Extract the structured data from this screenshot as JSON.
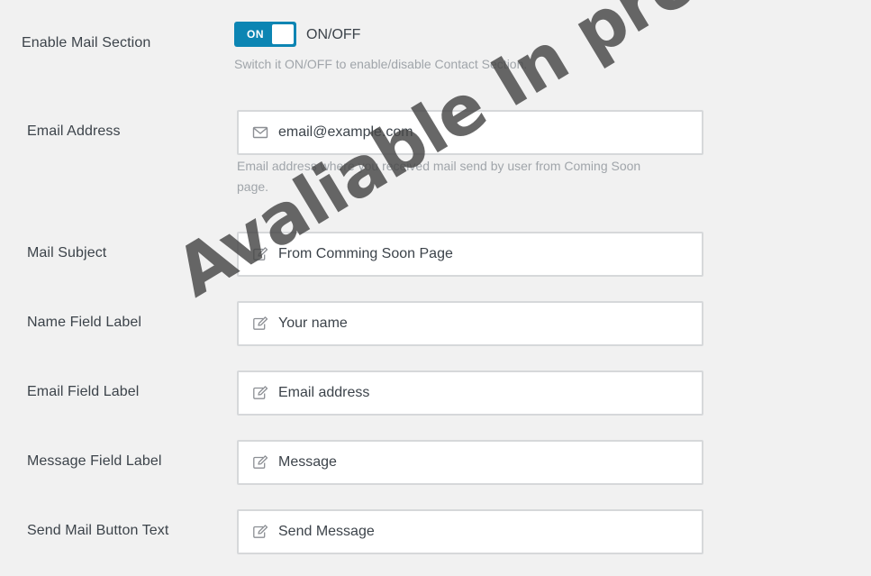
{
  "enable_mail": {
    "label": "Enable Mail Section",
    "toggle_state": "ON",
    "toggle_caption": "ON/OFF",
    "help": "Switch it ON/OFF to enable/disable Contact Section."
  },
  "email_address": {
    "label": "Email Address",
    "value": "email@example.com",
    "help_line1": "Email address where you received mail send by user from Coming Soon",
    "help_line2": "page.",
    "icon": "envelope-icon"
  },
  "mail_subject": {
    "label": "Mail Subject",
    "value": "From Comming Soon Page",
    "icon": "edit-icon"
  },
  "name_field_label": {
    "label": "Name Field Label",
    "value": "Your name",
    "icon": "edit-icon"
  },
  "email_field_label": {
    "label": "Email Field Label",
    "value": "Email address",
    "icon": "edit-icon"
  },
  "message_field_label": {
    "label": "Message Field Label",
    "value": "Message",
    "icon": "edit-icon"
  },
  "send_button_text": {
    "label": "Send Mail Button Text",
    "value": "Send Message",
    "icon": "edit-icon"
  },
  "watermark": "Avaliable In pro version",
  "colors": {
    "toggle_on": "#0c85b3",
    "help_text": "#a0a5aa",
    "field_border": "#d6d8da",
    "watermark": "#464646"
  }
}
